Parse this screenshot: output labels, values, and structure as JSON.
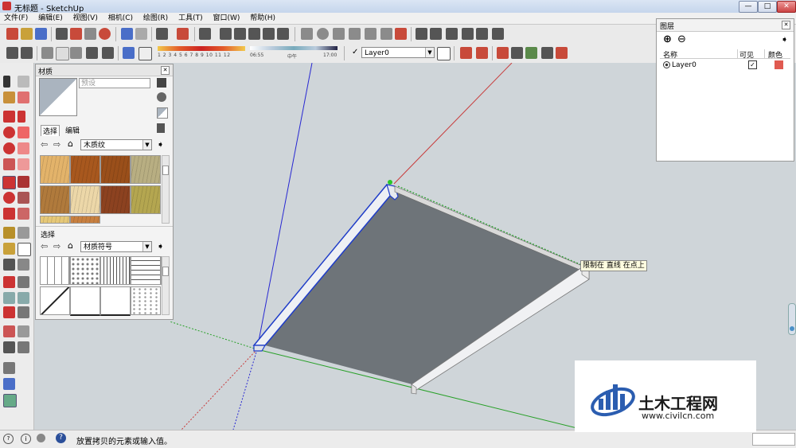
{
  "window": {
    "title": "无标题 - SketchUp",
    "min": "—",
    "max": "□",
    "close": "✕"
  },
  "menu": [
    "文件(F)",
    "编辑(E)",
    "视图(V)",
    "相机(C)",
    "绘图(R)",
    "工具(T)",
    "窗口(W)",
    "帮助(H)"
  ],
  "shadow_bar": {
    "months": [
      "1",
      "2",
      "3",
      "4",
      "5",
      "6",
      "7",
      "8",
      "9",
      "10",
      "11",
      "12"
    ],
    "time_start": "06:55",
    "time_mid": "中午",
    "time_end": "17:00"
  },
  "layer_toolbar": {
    "check": "✓",
    "current_layer": "Layer0"
  },
  "materials_panel": {
    "title": "材质",
    "name_placeholder": "预设",
    "tabs": [
      "选择",
      "编辑"
    ],
    "library_1": "木质纹",
    "second_label": "选择",
    "library_2": "材质符号",
    "wood_colors": [
      "#e3b36a",
      "#a8581e",
      "#9a4f1a",
      "#b8ae82",
      "#b07a3c",
      "#ecd7a8",
      "#8c4220",
      "#b4a650",
      "#e6c878",
      "#c88040"
    ]
  },
  "layers_panel": {
    "title": "图层",
    "add": "⊕",
    "remove": "⊖",
    "columns": [
      "名称",
      "可见",
      "颜色"
    ],
    "layer": {
      "name": "Layer0",
      "visible": true,
      "color": "#e05a50"
    }
  },
  "tooltip": "限制在 直线 在点上",
  "status": {
    "message": "放置拷贝的元素或输入值。"
  },
  "watermark": {
    "title": "土木工程网",
    "url": "www.civilcn.com"
  },
  "colors": {
    "axis_red": "#c83c3c",
    "axis_green": "#28a028",
    "axis_blue": "#2828d2",
    "face": "#6e7479",
    "edge_select": "#1e3cc8"
  }
}
